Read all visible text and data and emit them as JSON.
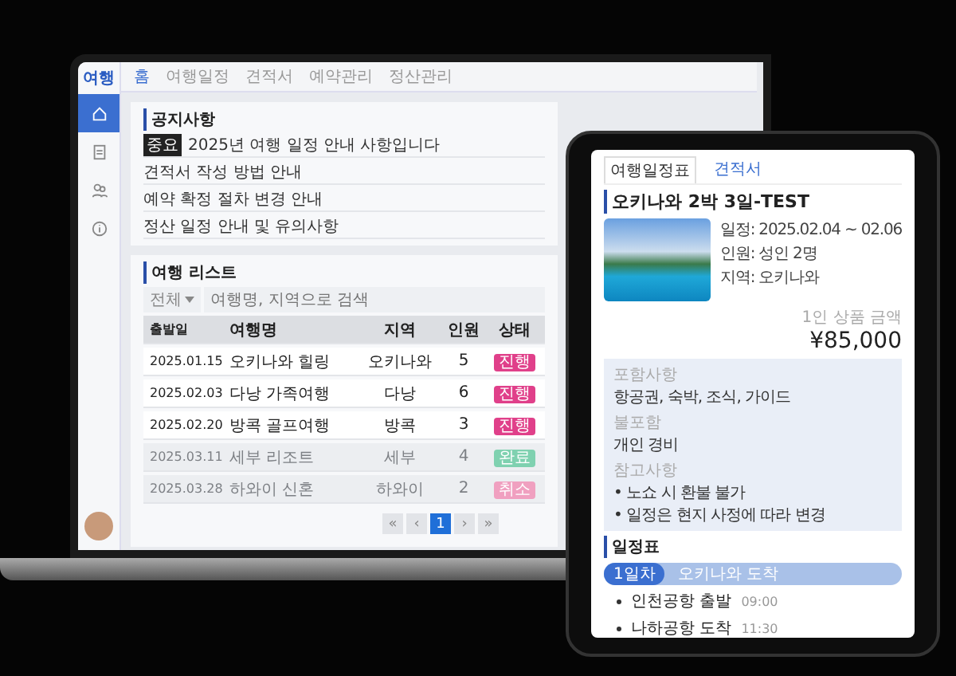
{
  "laptop": {
    "logo": "여행",
    "nav_tabs": [
      {
        "label": "홈",
        "selected": true
      },
      {
        "label": "여행일정",
        "selected": false
      },
      {
        "label": "견적서",
        "selected": false
      },
      {
        "label": "예약관리",
        "selected": false
      },
      {
        "label": "정산관리",
        "selected": false
      }
    ],
    "sidebar_items": [
      {
        "kind": "home",
        "selected": true
      },
      {
        "kind": "document",
        "selected": false
      },
      {
        "kind": "people",
        "selected": false
      },
      {
        "kind": "info",
        "selected": false
      }
    ],
    "notices": {
      "title": "공지사항",
      "items": [
        {
          "badge": "중요",
          "text": "2025년 여행 일정 안내 사항입니다"
        },
        {
          "text": "견적서 작성 방법 안내"
        },
        {
          "text": "예약 확정 절차 변경 안내"
        },
        {
          "text": "정산 일정 안내 및 유의사항"
        }
      ]
    },
    "trip_list": {
      "title": "여행 리스트",
      "filter": "전체",
      "search_placeholder": "여행명, 지역으로 검색",
      "columns": [
        "출발일",
        "여행명",
        "지역",
        "인원",
        "상태"
      ],
      "rows": [
        {
          "date": "2025.01.15",
          "name": "오키나와 힐링",
          "region": "오키나와",
          "count": "5",
          "status": "진행",
          "color": "#e0408a",
          "disabled": false
        },
        {
          "date": "2025.02.03",
          "name": "다낭 가족여행",
          "region": "다낭",
          "count": "6",
          "status": "진행",
          "color": "#e0408a",
          "disabled": false
        },
        {
          "date": "2025.02.20",
          "name": "방콕 골프여행",
          "region": "방콕",
          "count": "3",
          "status": "진행",
          "color": "#e0408a",
          "disabled": false
        },
        {
          "date": "2025.03.11",
          "name": "세부 리조트",
          "region": "세부",
          "count": "4",
          "status": "완료",
          "color": "#7fd1b0",
          "disabled": true
        },
        {
          "date": "2025.03.28",
          "name": "하와이 신혼",
          "region": "하와이",
          "count": "2",
          "status": "취소",
          "color": "#f0a0c0",
          "disabled": true
        }
      ]
    },
    "pagination": [
      {
        "label": "«",
        "selected": false
      },
      {
        "label": "‹",
        "selected": false
      },
      {
        "label": "1",
        "selected": true
      },
      {
        "label": "›",
        "selected": false
      },
      {
        "label": "»",
        "selected": false
      }
    ]
  },
  "tablet": {
    "tabs": [
      {
        "label": "여행일정표",
        "selected": true
      },
      {
        "label": "견적서",
        "selected": false
      }
    ],
    "title": "오키나와 2박 3일-TEST",
    "info": [
      "일정: 2025.02.04 ~ 02.06",
      "인원: 성인 2명",
      "지역: 오키나와"
    ],
    "price_label": "1인 상품 금액",
    "price": "¥85,000",
    "sections": [
      {
        "label": "포함사항",
        "lines": [
          "항공권, 숙박, 조식, 가이드"
        ]
      },
      {
        "label": "불포함",
        "lines": [
          "개인 경비"
        ]
      },
      {
        "label": "참고사항",
        "lines": [
          "• 노쇼 시 환불 불가",
          "• 일정은 현지 사정에 따라 변경"
        ]
      }
    ],
    "schedule_title": "일정표",
    "day_label": "1일차",
    "day_title": "오키나와 도착",
    "schedule": [
      {
        "text": "인천공항 출발",
        "time": "09:00"
      },
      {
        "text": "나하공항 도착",
        "time": "11:30"
      }
    ]
  }
}
